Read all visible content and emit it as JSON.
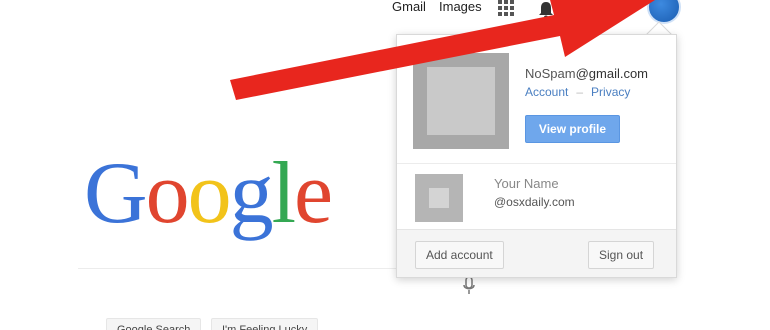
{
  "topbar": {
    "gmail_label": "Gmail",
    "images_label": "Images",
    "apps_icon": "apps-grid-icon",
    "notifications_icon": "bell-icon"
  },
  "logo": {
    "letters": [
      "G",
      "o",
      "o",
      "g",
      "l",
      "e"
    ],
    "colors": [
      "#3b73d8",
      "#e0452f",
      "#f2c31a",
      "#3b73d8",
      "#34a853",
      "#e0452f"
    ]
  },
  "search": {
    "mic_icon": "microphone-icon",
    "search_button": "Google Search",
    "lucky_button": "I'm Feeling Lucky"
  },
  "account_popup": {
    "email_user": "NoSpam",
    "email_domain": "@gmail.com",
    "account_link": "Account",
    "separator": "–",
    "privacy_link": "Privacy",
    "view_profile": "View profile",
    "secondary_name": "Your Name",
    "secondary_email": "@osxdaily.com",
    "add_account": "Add account",
    "sign_out": "Sign out"
  },
  "colors": {
    "arrow": "#e8261e",
    "link": "#4a7fc1",
    "button_primary": "#6fa7ec"
  }
}
